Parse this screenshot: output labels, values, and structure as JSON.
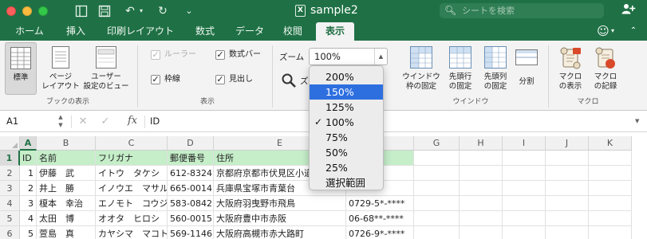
{
  "window": {
    "title": "sample2",
    "search_placeholder": "シートを検索"
  },
  "tabs": [
    {
      "label": "ホーム"
    },
    {
      "label": "挿入"
    },
    {
      "label": "印刷レイアウト"
    },
    {
      "label": "数式"
    },
    {
      "label": "データ"
    },
    {
      "label": "校閲"
    },
    {
      "label": "表示",
      "active": true
    }
  ],
  "ribbon": {
    "book_views": {
      "normal": "標準",
      "page_layout": "ページ\nレイアウト",
      "custom_views": "ユーザー\n設定のビュー",
      "group_label": "ブックの表示"
    },
    "show": {
      "ruler": "ルーラー",
      "formula_bar": "数式バー",
      "gridlines": "枠線",
      "headings": "見出し",
      "group_label": "表示"
    },
    "zoom": {
      "label": "ズーム",
      "value": "100%",
      "tool_label": "ズ"
    },
    "window": {
      "freeze_panes": "ウインドウ\n枠の固定",
      "freeze_top_row": "先頭行\nの固定",
      "freeze_first_col": "先頭列\nの固定",
      "split": "分割",
      "group_label": "ウインドウ"
    },
    "macros": {
      "view_macros": "マクロ\nの表示",
      "record_macro": "マクロ\nの記録",
      "group_label": "マクロ"
    }
  },
  "formula_bar": {
    "name_box": "A1",
    "fx": "fx",
    "value": "ID"
  },
  "sheet": {
    "columns": [
      "A",
      "B",
      "C",
      "D",
      "E",
      "F",
      "G",
      "H",
      "I",
      "J",
      "K"
    ],
    "selected_column": "A",
    "selected_row": "1",
    "rows": [
      {
        "num": "1",
        "cells": [
          "ID",
          "名前",
          "フリガナ",
          "郵便番号",
          "住所",
          ""
        ]
      },
      {
        "num": "2",
        "cells": [
          "1",
          "伊藤　武",
          "イトウ　タケシ",
          "612-8324",
          "京都府京都市伏見区小道",
          "*-****"
        ]
      },
      {
        "num": "3",
        "cells": [
          "2",
          "井上　勝",
          "イノウエ　マサル",
          "665-0014",
          "兵庫県宝塚市青葉台",
          "*-****"
        ]
      },
      {
        "num": "4",
        "cells": [
          "3",
          "榎本　幸治",
          "エノモト　コウジ",
          "583-0842",
          "大阪府羽曳野市飛鳥",
          "0729-5*-****"
        ]
      },
      {
        "num": "5",
        "cells": [
          "4",
          "太田　博",
          "オオタ　ヒロシ",
          "560-0015",
          "大阪府豊中市赤阪",
          "06-68**-****"
        ]
      },
      {
        "num": "6",
        "cells": [
          "5",
          "萱島　真",
          "カヤシマ　マコト",
          "569-1146",
          "大阪府高槻市赤大路町",
          "0726-9*-****"
        ]
      }
    ]
  },
  "zoom_menu": {
    "options": [
      {
        "label": "200%"
      },
      {
        "label": "150%",
        "highlighted": true
      },
      {
        "label": "125%"
      },
      {
        "label": "100%",
        "checked": true
      },
      {
        "label": "75%"
      },
      {
        "label": "50%"
      },
      {
        "label": "25%"
      },
      {
        "label": "選択範囲"
      }
    ],
    "check_mark": "✓"
  },
  "colors": {
    "accent": "#1f7145",
    "highlight": "#2e6fe0",
    "header_row_fill": "#c5eec9"
  }
}
